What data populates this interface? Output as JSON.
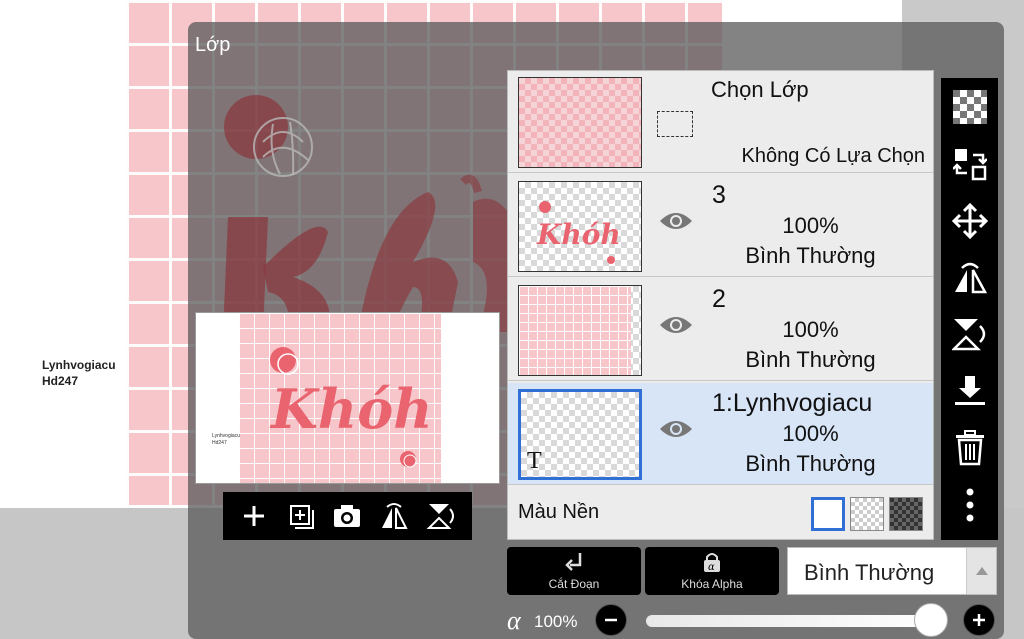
{
  "canvas": {
    "watermark_line1": "Lynhvogiacu",
    "watermark_line2": "Hd247"
  },
  "dialog": {
    "title": "Lớp"
  },
  "preview": {
    "artwork_text": "Khóh"
  },
  "preview_toolbar": {
    "icons": [
      "plus-icon",
      "add-layer-icon",
      "camera-icon",
      "flip-horizontal-icon",
      "flip-vertical-icon"
    ]
  },
  "selection_row": {
    "title": "Chọn Lớp",
    "status": "Không Có Lựa Chọn"
  },
  "layers": [
    {
      "name": "3",
      "opacity": "100%",
      "blend": "Bình Thường",
      "thumb_text": "Khóh",
      "selected": false
    },
    {
      "name": "2",
      "opacity": "100%",
      "blend": "Bình Thường",
      "selected": false
    },
    {
      "name": "1:Lynhvogiacu",
      "opacity": "100%",
      "blend": "Bình Thường",
      "thumb_glyph": "T",
      "selected": true
    }
  ],
  "background_row": {
    "label": "Màu Nền"
  },
  "right_toolbar": {
    "icons": [
      "checkerboard-icon",
      "transfer-icon",
      "move-icon",
      "flip-horizontal-icon",
      "flip-vertical-icon",
      "merge-down-icon",
      "trash-icon",
      "more-icon"
    ]
  },
  "bottom": {
    "clip_label": "Cắt Đoạn",
    "alpha_lock_label": "Khóa Alpha",
    "blend_mode": "Bình Thường",
    "alpha_symbol": "α",
    "alpha_value": "100%",
    "alpha_level": 1.0
  },
  "colors": {
    "pink": "#f6c6cb",
    "accent_blue": "#2f6fd6",
    "art_red": "#e9646f"
  }
}
